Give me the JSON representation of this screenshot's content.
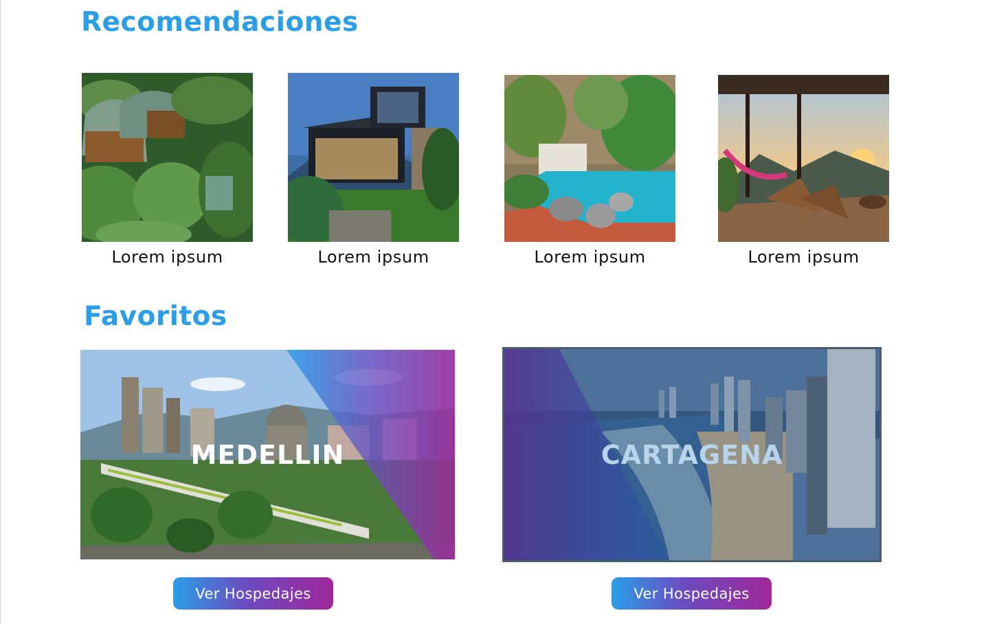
{
  "sections": {
    "recommendations_title": "Recomendaciones",
    "favorites_title": "Favoritos"
  },
  "recommendations": [
    {
      "label": "Lorem ipsum",
      "photo": "jungle-glamping-cabins"
    },
    {
      "label": "Lorem ipsum",
      "photo": "modern-glass-house"
    },
    {
      "label": "Lorem ipsum",
      "photo": "courtyard-pool"
    },
    {
      "label": "Lorem ipsum",
      "photo": "sunset-terrace-hammock"
    }
  ],
  "favorites": [
    {
      "name": "MEDELLIN",
      "button_label": "Ver Hospedajes",
      "photo": "city-skyline-metro"
    },
    {
      "name": "CARTAGENA",
      "button_label": "Ver Hospedajes",
      "photo": "beach-skyline"
    }
  ],
  "colors": {
    "title_blue": "#2a9ee8",
    "gradient_start": "#2a9ee8",
    "gradient_end": "#a0279a"
  }
}
